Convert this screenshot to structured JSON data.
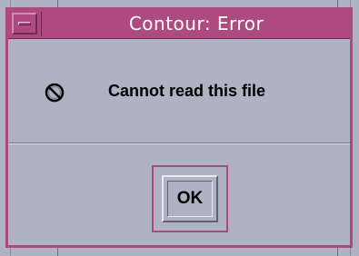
{
  "window": {
    "title": "Contour: Error"
  },
  "dialog": {
    "message": "Cannot read this file",
    "icon": "error-no-entry-icon"
  },
  "buttons": {
    "ok_label": "OK"
  },
  "colors": {
    "titlebar": "#ad4a7f",
    "background": "#aeb2c3",
    "title_text": "#ffffff"
  }
}
